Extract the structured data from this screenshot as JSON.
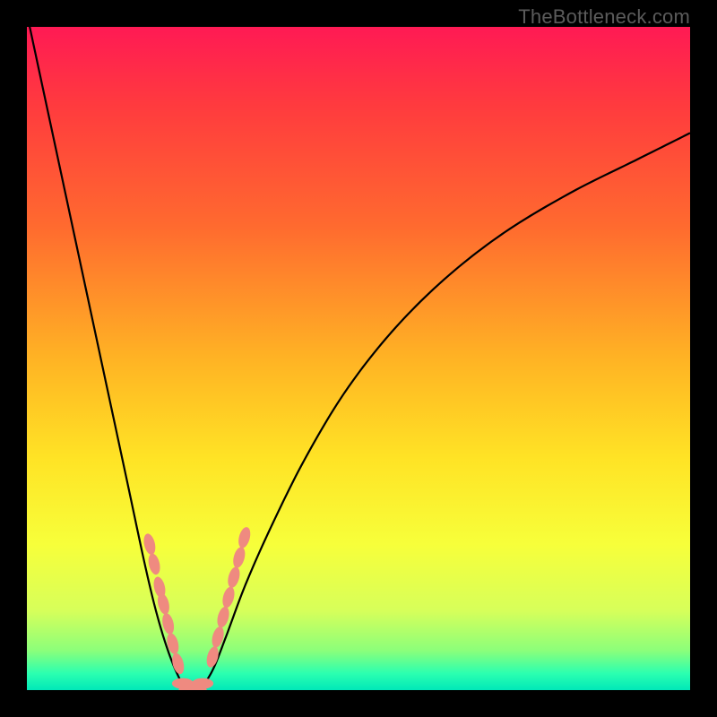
{
  "watermark": "TheBottleneck.com",
  "chart_data": {
    "type": "line",
    "title": "",
    "xlabel": "",
    "ylabel": "",
    "xlim": [
      0,
      100
    ],
    "ylim": [
      0,
      100
    ],
    "grid": false,
    "series": [
      {
        "name": "bottleneck-curve",
        "x": [
          0,
          3,
          6,
          9,
          12,
          15,
          18,
          20,
          22,
          24,
          25,
          26,
          28,
          30,
          33,
          37,
          42,
          48,
          55,
          63,
          72,
          82,
          92,
          100
        ],
        "y": [
          102,
          88,
          74,
          60,
          46,
          32,
          18,
          10,
          4,
          0,
          0,
          0,
          3,
          8,
          16,
          25,
          35,
          45,
          54,
          62,
          69,
          75,
          80,
          84
        ]
      },
      {
        "name": "marker-cluster-left",
        "x": [
          18.5,
          19.2,
          20.0,
          20.6,
          21.3,
          22.0,
          22.8
        ],
        "y": [
          22,
          19,
          15.5,
          13,
          10,
          7,
          4
        ]
      },
      {
        "name": "marker-cluster-bottom",
        "x": [
          23.5,
          24.5,
          25.5,
          26.5
        ],
        "y": [
          1,
          0,
          0,
          1
        ]
      },
      {
        "name": "marker-cluster-right",
        "x": [
          28.0,
          28.8,
          29.6,
          30.4,
          31.2,
          32.0,
          32.8
        ],
        "y": [
          5,
          8,
          11,
          14,
          17,
          20,
          23
        ]
      }
    ],
    "gradient_stops": [
      {
        "pos": 0.0,
        "color": "#ff1a54"
      },
      {
        "pos": 0.12,
        "color": "#ff3b3e"
      },
      {
        "pos": 0.3,
        "color": "#ff6a2f"
      },
      {
        "pos": 0.5,
        "color": "#ffb324"
      },
      {
        "pos": 0.65,
        "color": "#ffe325"
      },
      {
        "pos": 0.78,
        "color": "#f7ff3a"
      },
      {
        "pos": 0.88,
        "color": "#d7ff5a"
      },
      {
        "pos": 0.94,
        "color": "#8cff7a"
      },
      {
        "pos": 0.975,
        "color": "#2bffb0"
      },
      {
        "pos": 1.0,
        "color": "#00e8b8"
      }
    ],
    "marker_style": {
      "fill": "#ef8a80",
      "rx": 6,
      "ry": 12,
      "rotate_with_curve": true
    },
    "curve_style": {
      "stroke": "#000000",
      "width": 2.2
    }
  }
}
